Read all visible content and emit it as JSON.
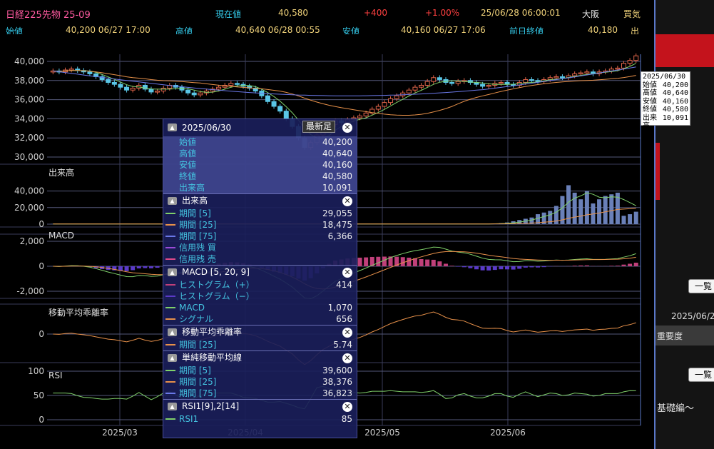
{
  "header": {
    "instrument": "日経225先物 25-09",
    "current_label": "現在値",
    "current_value": "40,580",
    "change": "+400",
    "change_pct": "+1.00%",
    "datetime": "25/06/28  06:00:01",
    "market": "大阪",
    "buy_label": "買気",
    "open_label": "始値",
    "open_value": "40,200  06/27  17:00",
    "high_label": "高値",
    "high_value": "40,640  06/28  00:55",
    "low_label": "安値",
    "low_value": "40,160  06/27  17:06",
    "prev_close_label": "前日終値",
    "prev_close_value": "40,180",
    "extra_label": "出"
  },
  "price_axis": [
    "40,000",
    "38,000",
    "36,000",
    "34,000",
    "32,000",
    "30,000"
  ],
  "volume_pane": {
    "label": "出来高",
    "ticks": [
      "40,000",
      "20,000",
      "0"
    ]
  },
  "macd_pane": {
    "label": "MACD",
    "ticks": [
      "2,000",
      "0",
      "-2,000"
    ]
  },
  "dev_pane": {
    "label": "移動平均乖離率",
    "ticks": [
      "0"
    ]
  },
  "rsi_pane": {
    "label": "RSI",
    "ticks": [
      "100",
      "50",
      "0"
    ]
  },
  "x_axis": [
    "2025/03",
    "2025/04",
    "2025/05",
    "2025/06"
  ],
  "tooltip": {
    "date": "2025/06/30",
    "rows": [
      {
        "k": "始値",
        "v": "40,200"
      },
      {
        "k": "高値",
        "v": "40,640"
      },
      {
        "k": "安値",
        "v": "40,160"
      },
      {
        "k": "終値",
        "v": "40,580"
      },
      {
        "k": "出来高",
        "v": "10,091"
      }
    ]
  },
  "panel": {
    "date": "2025/06/30",
    "latest_btn": "最新足",
    "ohlc": [
      {
        "k": "始値",
        "v": "40,200"
      },
      {
        "k": "高値",
        "v": "40,640"
      },
      {
        "k": "安値",
        "v": "40,160"
      },
      {
        "k": "終値",
        "v": "40,580"
      },
      {
        "k": "出来高",
        "v": "10,091"
      }
    ],
    "volume": {
      "title": "出来高",
      "rows": [
        {
          "k": "期間 [5]",
          "v": "29,055",
          "color": "#7fd06a"
        },
        {
          "k": "期間 [25]",
          "v": "18,475",
          "color": "#e8914a"
        },
        {
          "k": "期間 [75]",
          "v": "6,366",
          "color": "#6a78e8"
        },
        {
          "k": "信用残 買",
          "v": "",
          "color": "#9a4ad8"
        },
        {
          "k": "信用残 売",
          "v": "",
          "color": "#e04a8a"
        }
      ]
    },
    "macd": {
      "title": "MACD [5, 20, 9]",
      "rows": [
        {
          "k": "ヒストグラム（+）",
          "v": "414",
          "color": "#c0407a"
        },
        {
          "k": "ヒストグラム（−）",
          "v": "",
          "color": "#5a3ac8"
        },
        {
          "k": "MACD",
          "v": "1,070",
          "color": "#7fd06a"
        },
        {
          "k": "シグナル",
          "v": "656",
          "color": "#e8914a"
        }
      ]
    },
    "deviation": {
      "title": "移動平均乖離率",
      "rows": [
        {
          "k": "期間 [25]",
          "v": "5.74",
          "color": "#e8914a"
        }
      ]
    },
    "sma": {
      "title": "単純移動平均線",
      "rows": [
        {
          "k": "期間 [5]",
          "v": "39,600",
          "color": "#7fd06a"
        },
        {
          "k": "期間 [25]",
          "v": "38,376",
          "color": "#e8914a"
        },
        {
          "k": "期間 [75]",
          "v": "36,823",
          "color": "#6a78e8"
        }
      ]
    },
    "rsi": {
      "title": "RSI1[9],2[14]",
      "rows": [
        {
          "k": "RSI1",
          "v": "85",
          "color": "#7fd06a"
        }
      ]
    }
  },
  "right_side": {
    "list_btn1": "一覧",
    "date_text": "2025/06/2",
    "importance": "重要度",
    "list_btn2": "一覧",
    "basics": "基礎編～"
  },
  "colors": {
    "up": "#e0654a",
    "down": "#5ac6e6",
    "sma5": "#7fd06a",
    "sma25": "#e8914a",
    "sma75": "#6a78e8"
  }
}
